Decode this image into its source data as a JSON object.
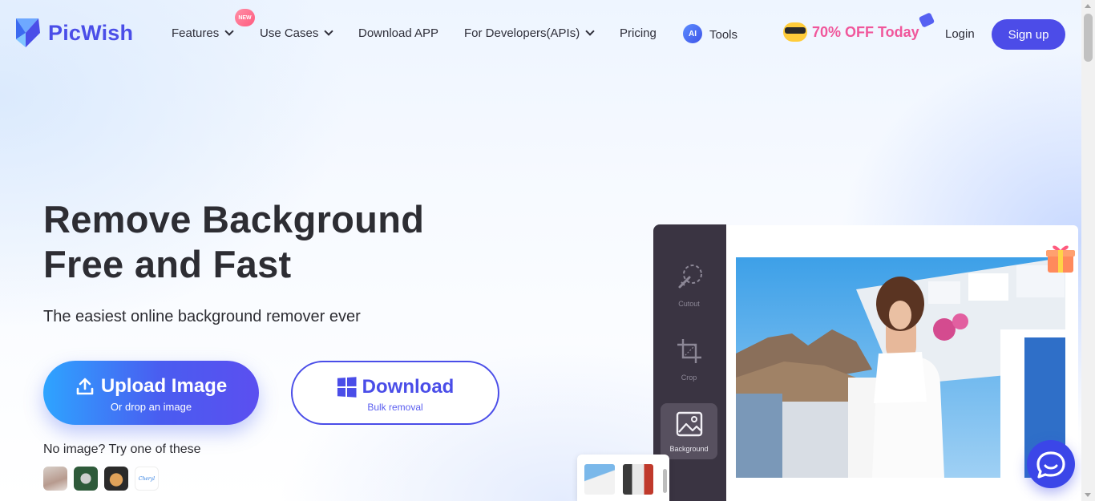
{
  "header": {
    "logo_text": "PicWish",
    "nav": {
      "features": "Features",
      "new_badge": "NEW",
      "use_cases": "Use Cases",
      "download_app": "Download APP",
      "developers": "For Developers(APIs)",
      "pricing": "Pricing",
      "ai_badge": "AI",
      "tools": "Tools"
    },
    "promo": "70% OFF Today",
    "login": "Login",
    "signup": "Sign up"
  },
  "hero": {
    "title_line1": "Remove Background",
    "title_line2": "Free and Fast",
    "subtitle": "The easiest online background remover ever",
    "upload_label": "Upload Image",
    "upload_sub": "Or drop an image",
    "download_label": "Download",
    "download_sub": "Bulk removal",
    "try_text": "No image? Try one of these",
    "sample_text": "Cheryl"
  },
  "editor": {
    "tools": [
      {
        "label": "Cutout",
        "icon": "cutout-icon"
      },
      {
        "label": "Crop",
        "icon": "crop-icon"
      },
      {
        "label": "Background",
        "icon": "image-icon"
      }
    ]
  },
  "colors": {
    "brand": "#4a4ee8",
    "promo": "#f0579b",
    "editor_sidebar": "#3a3442"
  }
}
